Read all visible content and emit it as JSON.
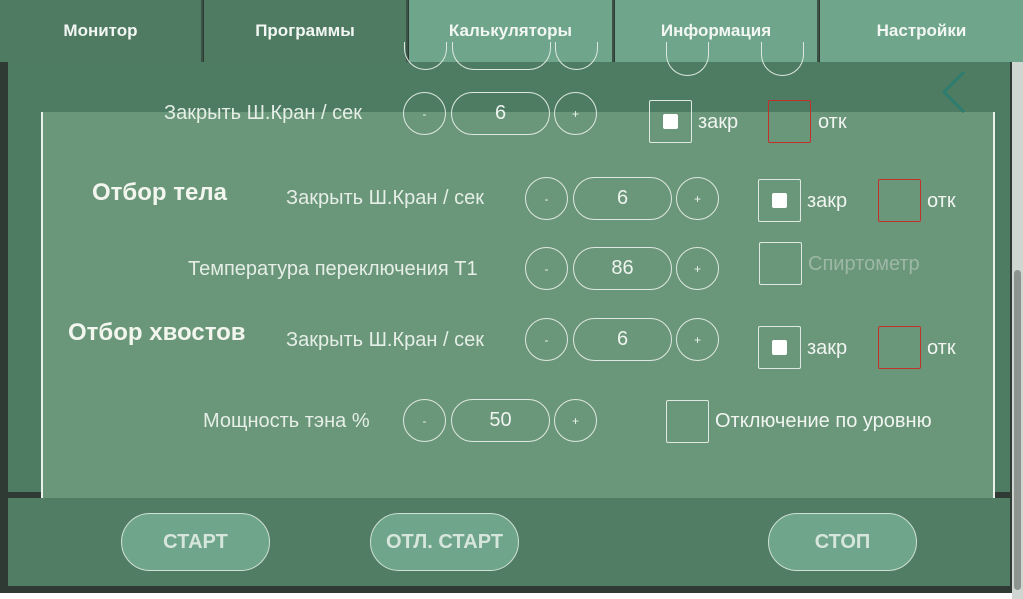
{
  "tabs": [
    {
      "label": "Монитор"
    },
    {
      "label": "Программы"
    },
    {
      "label": "Калькуляторы"
    },
    {
      "label": "Информация"
    },
    {
      "label": "Настройки"
    }
  ],
  "rows": {
    "valve_close_1": {
      "label": "Закрыть Ш.Кран / сек",
      "minus": "-",
      "value": "6",
      "plus": "+",
      "close_label": "закр",
      "open_label": "отк"
    },
    "body": {
      "section": "Отбор тела",
      "label": "Закрыть Ш.Кран / сек",
      "minus": "-",
      "value": "6",
      "plus": "+",
      "close_label": "закр",
      "open_label": "отк"
    },
    "switch_temp": {
      "label": "Температура переключения Т1",
      "minus": "-",
      "value": "86",
      "plus": "+",
      "checkbox_label": "Спиртометр"
    },
    "tails": {
      "section": "Отбор хвостов",
      "label": "Закрыть Ш.Кран / сек",
      "minus": "-",
      "value": "6",
      "plus": "+",
      "close_label": "закр",
      "open_label": "отк"
    },
    "power": {
      "label": "Мощность тэна %",
      "minus": "-",
      "value": "50",
      "plus": "+",
      "checkbox_label": "Отключение по уровню"
    }
  },
  "actions": {
    "start": "СТАРТ",
    "delayed_start": "ОТЛ. СТАРТ",
    "stop": "СТОП"
  },
  "colors": {
    "tab_dark": "#4f7b63",
    "tab_light": "#6fa58a",
    "panel": "#6a9679",
    "open_box_border": "#c2302a"
  },
  "icons": {
    "back": "chevron-left-icon"
  }
}
